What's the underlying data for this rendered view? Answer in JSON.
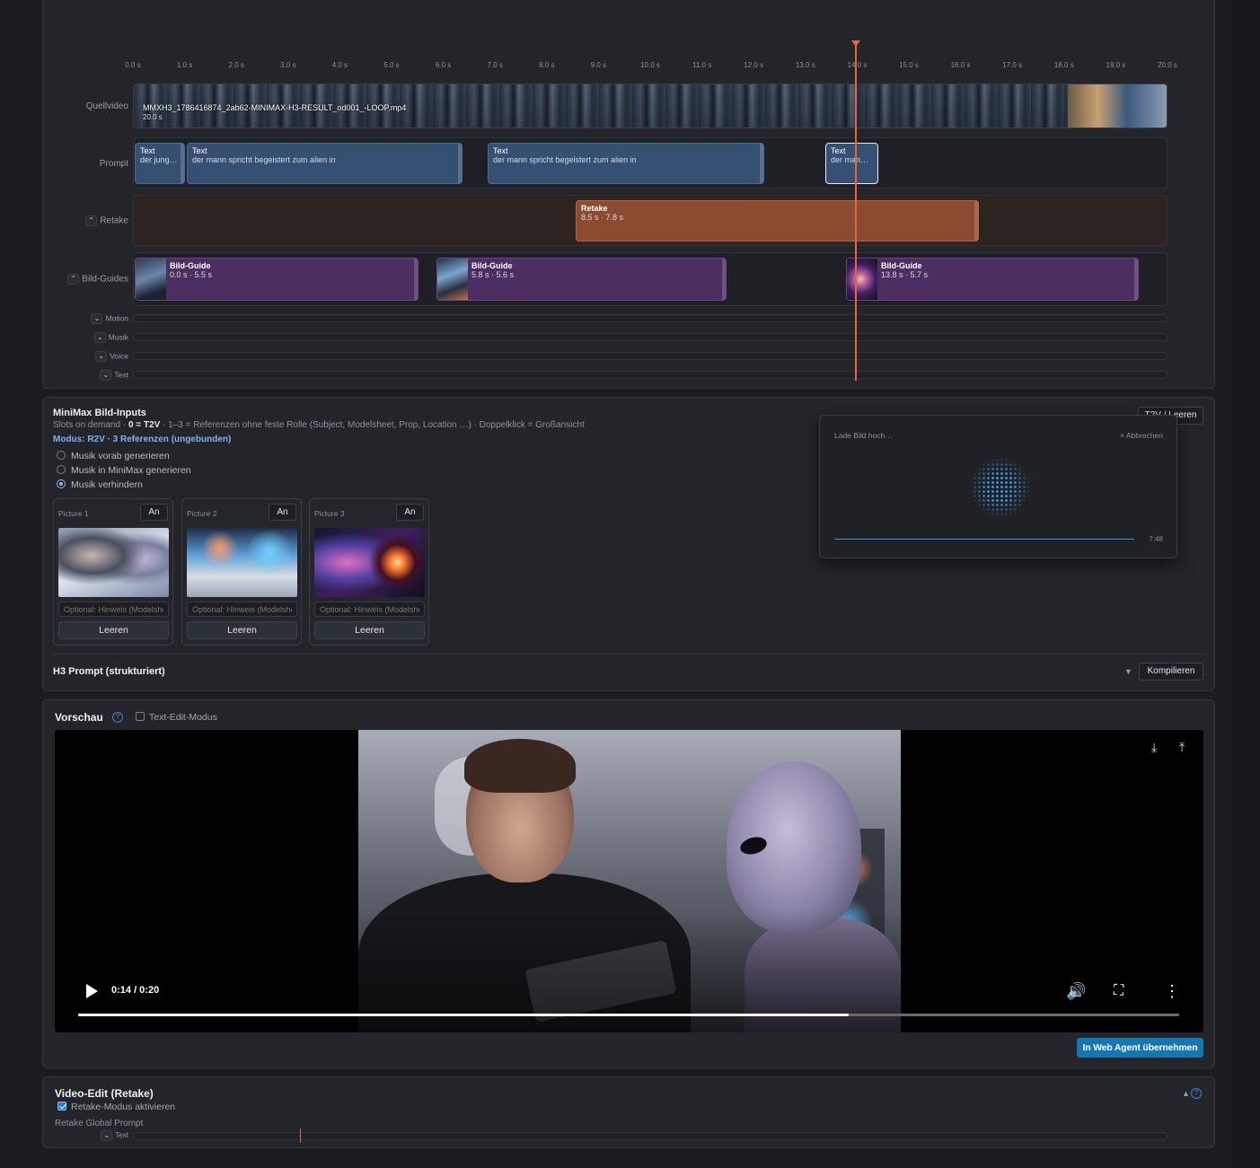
{
  "colors": {
    "accent": "#1577b0",
    "playhead": "#e8643a",
    "prompt_clip": "#355073",
    "retake_clip": "#8a4b30",
    "guide_clip": "#4d2e62"
  },
  "timeline": {
    "ticks": [
      "0.0 s",
      "1.0 s",
      "2.0 s",
      "3.0 s",
      "4.0 s",
      "5.0 s",
      "6.0 s",
      "7.0 s",
      "8.0 s",
      "9.0 s",
      "10.0 s",
      "11.0 s",
      "12.0 s",
      "13.0 s",
      "14.0 s",
      "15.0 s",
      "16.0 s",
      "17.0 s",
      "18.0 s",
      "19.0 s",
      "20.0 s"
    ],
    "playhead_seconds": 14.0,
    "tracks": {
      "source": {
        "label": "Quellvideo",
        "file_name": "MMXH3_1786416874_2ab62-MINIMAX-H3-RESULT_od001_-LOOP.mp4",
        "duration": "20.0 s"
      },
      "prompt": {
        "label": "Prompt",
        "clips": [
          {
            "title": "Text",
            "subtitle": "der junge ..."
          },
          {
            "title": "Text",
            "subtitle": "der mann spricht begeistert zum alien in"
          },
          {
            "title": "Text",
            "subtitle": "der mann spricht begeistert zum alien in"
          },
          {
            "title": "Text",
            "subtitle": "der mann ..."
          }
        ]
      },
      "retake": {
        "label": "Retake",
        "clips": [
          {
            "title": "Retake",
            "subtitle": "8.5 s · 7.8 s"
          }
        ]
      },
      "guides": {
        "label": "Bild-Guides",
        "clips": [
          {
            "title": "Bild-Guide",
            "subtitle": "0.0 s · 5.5 s"
          },
          {
            "title": "Bild-Guide",
            "subtitle": "5.8 s · 5.6 s"
          },
          {
            "title": "Bild-Guide",
            "subtitle": "13.8 s · 5.7 s"
          }
        ]
      },
      "motion": {
        "label": "Motion"
      },
      "music": {
        "label": "Musik"
      },
      "voice": {
        "label": "Voice"
      },
      "text": {
        "label": "Text"
      }
    }
  },
  "inputs": {
    "title": "MiniMax Bild-Inputs",
    "subtitle_pre": "Slots on demand · ",
    "subtitle_bold": "0 = T2V",
    "subtitle_post": " · 1–3 = Referenzen ohne feste Rolle (Subject, Modelsheet, Prop, Location …) · Doppelklick = Großansicht",
    "modus": "Modus: R2V · 3 Referenzen (ungebunden)",
    "t2v_button": "T2V / Leeren",
    "music_options": [
      {
        "label": "Musik vorab generieren",
        "selected": false
      },
      {
        "label": "Musik in MiniMax generieren",
        "selected": false
      },
      {
        "label": "Musik verhindern",
        "selected": true
      }
    ],
    "pictures": [
      {
        "label": "Picture 1",
        "toggle": "An",
        "hint_placeholder": "Optional: Hinweis (Modelsheet...",
        "clear": "Leeren"
      },
      {
        "label": "Picture 2",
        "toggle": "An",
        "hint_placeholder": "Optional: Hinweis (Modelsheet...",
        "clear": "Leeren"
      },
      {
        "label": "Picture 3",
        "toggle": "An",
        "hint_placeholder": "Optional: Hinweis (Modelsheet...",
        "clear": "Leeren"
      }
    ],
    "h3_prompt_title": "H3 Prompt (strukturiert)",
    "compile_button": "Kompilieren",
    "upload": {
      "title": "Lade Bild hoch…",
      "cancel": "Abbrechen",
      "time": "7:48"
    }
  },
  "preview": {
    "title": "Vorschau",
    "text_edit_label": "Text-Edit-Modus",
    "text_edit_checked": false,
    "time_display": "0:14 / 0:20",
    "progress": 0.7,
    "web_agent_button": "In Web Agent übernehmen"
  },
  "video_edit": {
    "title": "Video-Edit (Retake)",
    "enable_label": "Retake-Modus aktivieren",
    "enabled": true,
    "global_prompt_label": "Retake Global Prompt",
    "text_track_label": "Text"
  }
}
